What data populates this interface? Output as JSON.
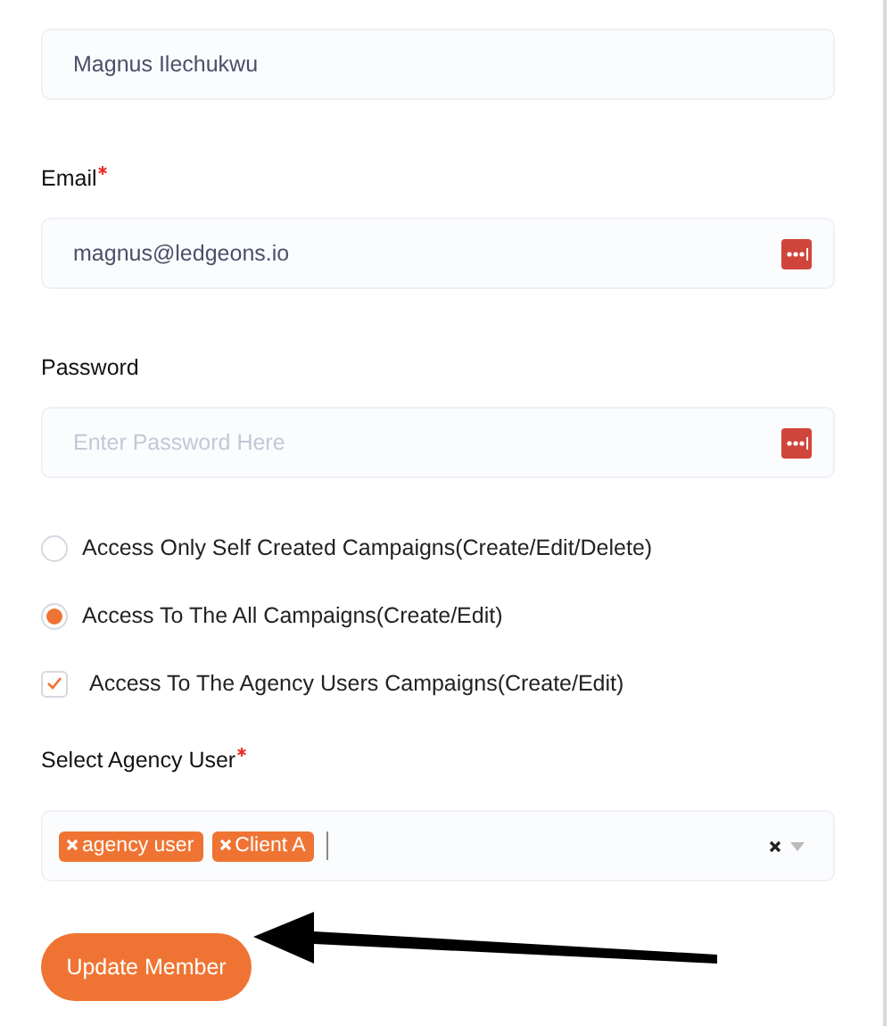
{
  "name_field": {
    "value": "Magnus Ilechukwu"
  },
  "email": {
    "label": "Email",
    "required": true,
    "value": "magnus@ledgeons.io"
  },
  "password": {
    "label": "Password",
    "required": false,
    "placeholder": "Enter Password Here"
  },
  "access_options": [
    {
      "kind": "radio",
      "label": "Access Only Self Created Campaigns(Create/Edit/Delete)",
      "selected": false
    },
    {
      "kind": "radio",
      "label": "Access To The All Campaigns(Create/Edit)",
      "selected": true
    },
    {
      "kind": "checkbox",
      "label": "Access To The Agency Users Campaigns(Create/Edit)",
      "checked": true
    }
  ],
  "agency_user": {
    "label": "Select Agency User",
    "required": true,
    "tags": [
      "agency user",
      "Client A"
    ]
  },
  "submit": {
    "label": "Update Member"
  }
}
